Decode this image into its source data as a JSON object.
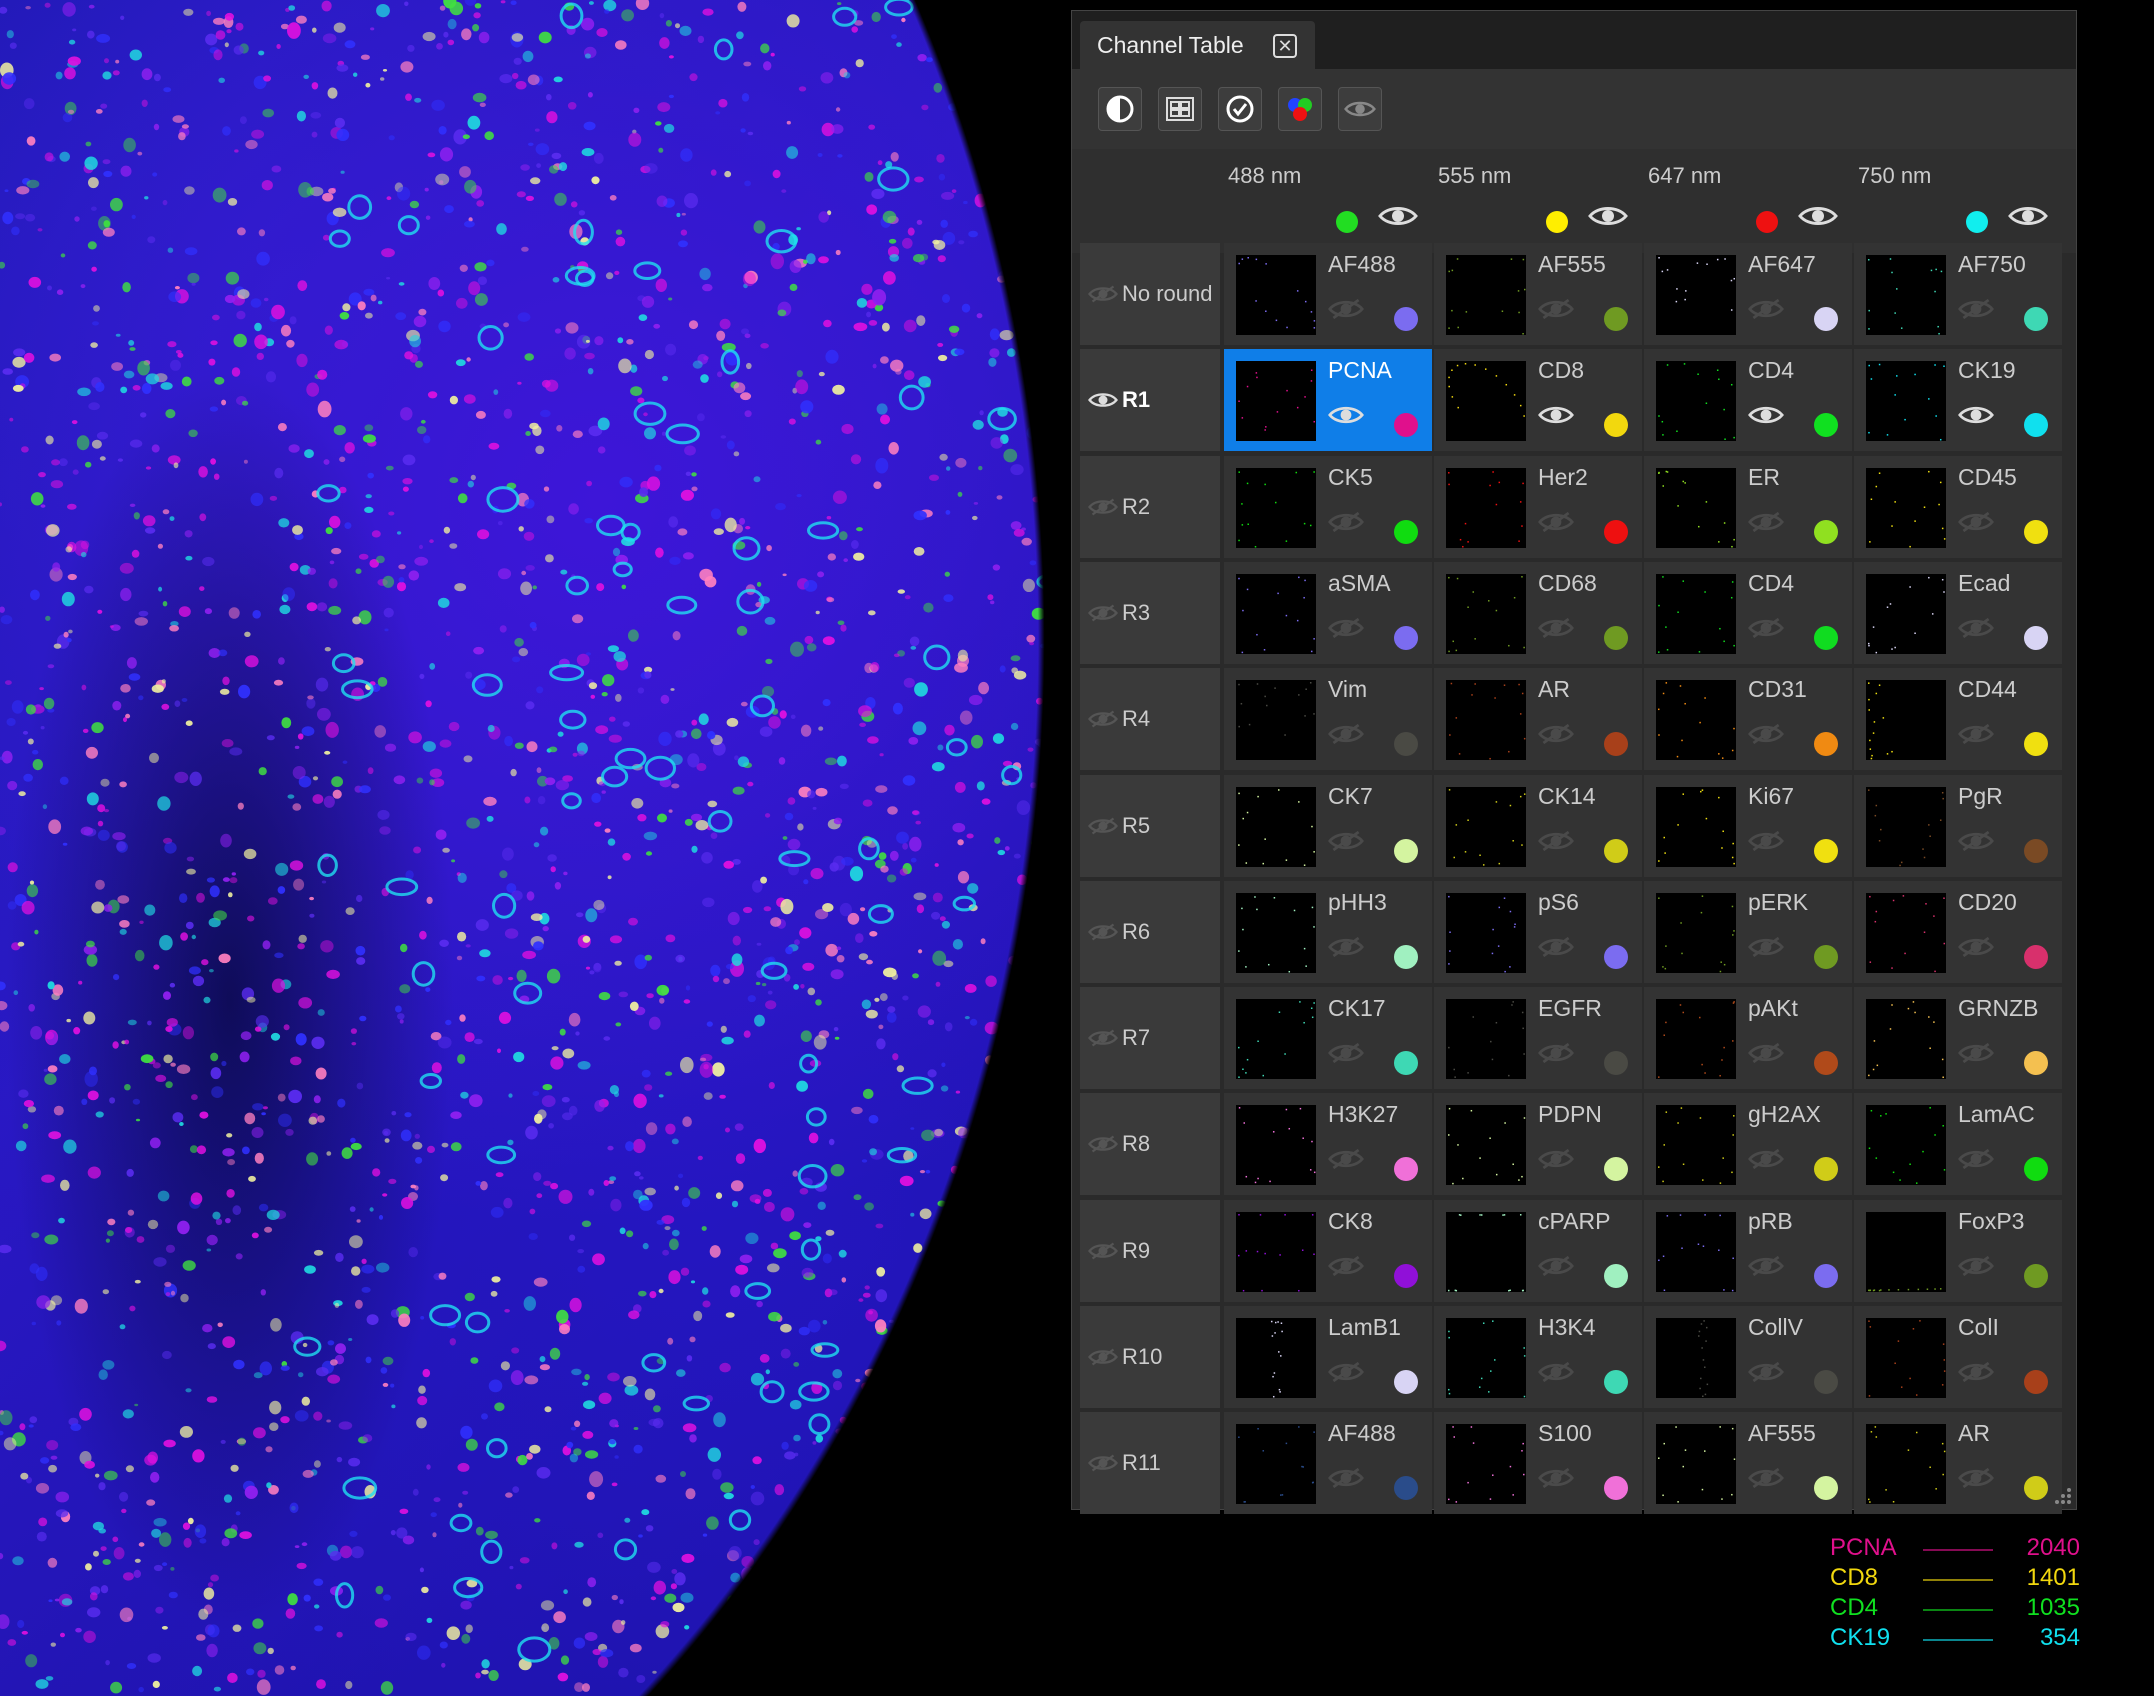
{
  "panel": {
    "tab_title": "Channel Table",
    "toolbar": [
      {
        "icon": "contrast-icon"
      },
      {
        "icon": "grid-layout-icon"
      },
      {
        "icon": "check-circle-icon"
      },
      {
        "icon": "color-mix-icon"
      },
      {
        "icon": "eye-icon"
      }
    ],
    "wavelengths": [
      {
        "label": "488 nm",
        "color": "#22dd22"
      },
      {
        "label": "555 nm",
        "color": "#ffee00"
      },
      {
        "label": "647 nm",
        "color": "#ee1111"
      },
      {
        "label": "750 nm",
        "color": "#11eeee"
      }
    ],
    "rows": [
      {
        "label": "No round",
        "visible": false,
        "channels": [
          {
            "name": "AF488",
            "color": "#7b6cf0",
            "visible": false
          },
          {
            "name": "AF555",
            "color": "#6f9a22",
            "visible": false
          },
          {
            "name": "AF647",
            "color": "#d8d4f4",
            "visible": false
          },
          {
            "name": "AF750",
            "color": "#3ed8b4",
            "visible": false
          }
        ]
      },
      {
        "label": "R1",
        "visible": true,
        "channels": [
          {
            "name": "PCNA",
            "color": "#e0108c",
            "visible": true,
            "selected": true
          },
          {
            "name": "CD8",
            "color": "#f2d80e",
            "visible": true
          },
          {
            "name": "CD4",
            "color": "#10e020",
            "visible": true
          },
          {
            "name": "CK19",
            "color": "#10e0ee",
            "visible": true
          }
        ]
      },
      {
        "label": "R2",
        "visible": false,
        "channels": [
          {
            "name": "CK5",
            "color": "#10dc10",
            "visible": false
          },
          {
            "name": "Her2",
            "color": "#ee1010",
            "visible": false
          },
          {
            "name": "ER",
            "color": "#90e020",
            "visible": false
          },
          {
            "name": "CD45",
            "color": "#f0e010",
            "visible": false
          }
        ]
      },
      {
        "label": "R3",
        "visible": false,
        "channels": [
          {
            "name": "aSMA",
            "color": "#7b6cf0",
            "visible": false
          },
          {
            "name": "CD68",
            "color": "#6f9a22",
            "visible": false
          },
          {
            "name": "CD4",
            "color": "#10dc20",
            "visible": false
          },
          {
            "name": "Ecad",
            "color": "#d8d4f4",
            "visible": false
          }
        ]
      },
      {
        "label": "R4",
        "visible": false,
        "channels": [
          {
            "name": "Vim",
            "color": "#4a4a44",
            "visible": false
          },
          {
            "name": "AR",
            "color": "#a8401a",
            "visible": false
          },
          {
            "name": "CD31",
            "color": "#f08a12",
            "visible": false
          },
          {
            "name": "CD44",
            "color": "#f0e010",
            "visible": false
          }
        ]
      },
      {
        "label": "R5",
        "visible": false,
        "channels": [
          {
            "name": "CK7",
            "color": "#d4f4a0",
            "visible": false
          },
          {
            "name": "CK14",
            "color": "#d0cc18",
            "visible": false
          },
          {
            "name": "Ki67",
            "color": "#f0e010",
            "visible": false
          },
          {
            "name": "PgR",
            "color": "#7a4a24",
            "visible": false
          }
        ]
      },
      {
        "label": "R6",
        "visible": false,
        "channels": [
          {
            "name": "pHH3",
            "color": "#a0f0c0",
            "visible": false
          },
          {
            "name": "pS6",
            "color": "#7b6cf0",
            "visible": false
          },
          {
            "name": "pERK",
            "color": "#6f9a22",
            "visible": false
          },
          {
            "name": "CD20",
            "color": "#d8306c",
            "visible": false
          }
        ]
      },
      {
        "label": "R7",
        "visible": false,
        "channels": [
          {
            "name": "CK17",
            "color": "#3ed8b4",
            "visible": false
          },
          {
            "name": "EGFR",
            "color": "#4a4a44",
            "visible": false
          },
          {
            "name": "pAKt",
            "color": "#b04a1a",
            "visible": false
          },
          {
            "name": "GRNZB",
            "color": "#f4c050",
            "visible": false
          }
        ]
      },
      {
        "label": "R8",
        "visible": false,
        "channels": [
          {
            "name": "H3K27",
            "color": "#f070d8",
            "visible": false
          },
          {
            "name": "PDPN",
            "color": "#d4f4a0",
            "visible": false
          },
          {
            "name": "gH2AX",
            "color": "#d0cc18",
            "visible": false
          },
          {
            "name": "LamAC",
            "color": "#10dc10",
            "visible": false
          }
        ]
      },
      {
        "label": "R9",
        "visible": false,
        "channels": [
          {
            "name": "CK8",
            "color": "#9010d8",
            "visible": false
          },
          {
            "name": "cPARP",
            "color": "#a0f0c0",
            "visible": false
          },
          {
            "name": "pRB",
            "color": "#7b6cf0",
            "visible": false
          },
          {
            "name": "FoxP3",
            "color": "#6f9a22",
            "visible": false
          }
        ]
      },
      {
        "label": "R10",
        "visible": false,
        "channels": [
          {
            "name": "LamB1",
            "color": "#d8d4f4",
            "visible": false
          },
          {
            "name": "H3K4",
            "color": "#3ed8b4",
            "visible": false
          },
          {
            "name": "CollV",
            "color": "#4a4a44",
            "visible": false
          },
          {
            "name": "ColI",
            "color": "#a8401a",
            "visible": false
          }
        ]
      },
      {
        "label": "R11",
        "visible": false,
        "channels": [
          {
            "name": "AF488",
            "color": "#2a4c8a",
            "visible": false
          },
          {
            "name": "S100",
            "color": "#f070d8",
            "visible": false
          },
          {
            "name": "AF555",
            "color": "#d4f4a0",
            "visible": false
          },
          {
            "name": "AR",
            "color": "#d0cc18",
            "visible": false
          }
        ]
      }
    ]
  },
  "legend": [
    {
      "name": "PCNA",
      "value": "2040",
      "color": "#e0108c"
    },
    {
      "name": "CD8",
      "value": "1401",
      "color": "#f2d80e"
    },
    {
      "name": "CD4",
      "value": "1035",
      "color": "#10e020"
    },
    {
      "name": "CK19",
      "value": "354",
      "color": "#10e0ee"
    }
  ]
}
